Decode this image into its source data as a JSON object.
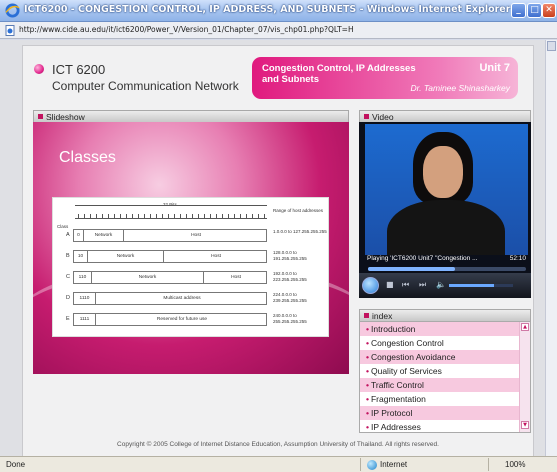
{
  "window": {
    "title": "ICT6200 - CONGESTION CONTROL, IP ADDRESS, AND SUBNETS - Windows Internet Explorer",
    "url": "http://www.cide.au.edu/it/ict6200/Power_V/Version_01/Chapter_07/vis_chp01.php?QLT=H",
    "min_label": "_",
    "max_label": "□",
    "close_label": "✕"
  },
  "header": {
    "course_code": "ICT 6200",
    "course_name": "Computer Communication Network",
    "chapter_title": "Congestion Control, IP Addresses and Subnets",
    "unit": "Unit 7",
    "instructor": "Dr. Taminee Shinasharkey"
  },
  "slideshow": {
    "header_label": "Slideshow",
    "slide_title": "Classes",
    "diagram": {
      "bits_label": "32 Bits",
      "class_label": "Class",
      "range_header": "Range of host addresses",
      "rows": [
        {
          "cls": "A",
          "prefix": "0",
          "fields": [
            "Network",
            "Host"
          ],
          "range": "1.0.0.0 to 127.255.255.255"
        },
        {
          "cls": "B",
          "prefix": "10",
          "fields": [
            "Network",
            "Host"
          ],
          "range": "128.0.0.0 to 191.255.255.255"
        },
        {
          "cls": "C",
          "prefix": "110",
          "fields": [
            "Network",
            "Host"
          ],
          "range": "192.0.0.0 to 223.255.255.255"
        },
        {
          "cls": "D",
          "prefix": "1110",
          "fields": [
            "Multicast address"
          ],
          "range": "224.0.0.0 to 239.255.255.255"
        },
        {
          "cls": "E",
          "prefix": "1111",
          "fields": [
            "Reserved for future use"
          ],
          "range": "240.0.0.0 to 255.255.255.255"
        }
      ]
    }
  },
  "video": {
    "header_label": "Video",
    "now_playing": "Playing 'ICT6200 Unit7 \"Congestion ...",
    "time": "52:10",
    "progress_fraction": 0.55,
    "volume_fraction": 0.7
  },
  "index": {
    "header_label": "index",
    "items": [
      {
        "label": "Introduction",
        "highlight": true
      },
      {
        "label": "Congestion Control",
        "highlight": false
      },
      {
        "label": "Congestion Avoidance",
        "highlight": true
      },
      {
        "label": "Quality of Services",
        "highlight": false
      },
      {
        "label": "Traffic Control",
        "highlight": true
      },
      {
        "label": "Fragmentation",
        "highlight": false
      },
      {
        "label": "IP Protocol",
        "highlight": true
      },
      {
        "label": "IP Addresses",
        "highlight": false
      }
    ]
  },
  "footer": {
    "copyright": "Copyright © 2005 College of Internet Distance Education, Assumption University of Thailand. All rights reserved."
  },
  "status": {
    "left": "Done",
    "zone": "Internet",
    "zoom": "100%"
  },
  "colors": {
    "accent": "#c2125f",
    "banner": "#e0197e"
  }
}
